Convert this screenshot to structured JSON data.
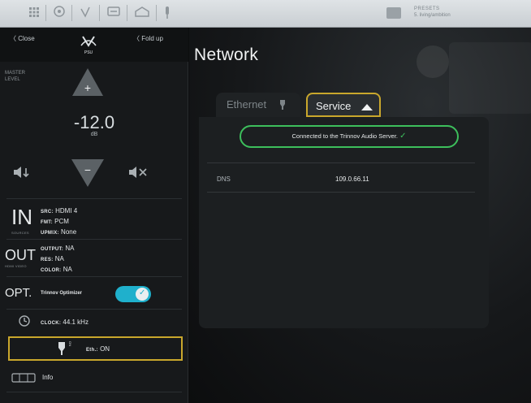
{
  "topbar": {
    "presets_label": "PRESETS",
    "preset_name": "5. living/ambition"
  },
  "sidebar": {
    "close_label": "Close",
    "fold_label": "Fold up",
    "logo_text": "PSU",
    "master_level_label": "MASTER\nLEVEL",
    "volume_value": "-12.0",
    "volume_unit": "dB",
    "input": {
      "big": "IN",
      "caption": "SOURCES",
      "src_key": "SRC:",
      "src_val": "HDMI 4",
      "fmt_key": "FMT:",
      "fmt_val": "PCM",
      "upmix_key": "UPMIX:",
      "upmix_val": "None"
    },
    "output": {
      "big": "OUT",
      "caption": "HDMI VIDEO",
      "output_key": "OUTPUT:",
      "output_val": "NA",
      "res_key": "RES:",
      "res_val": "NA",
      "color_key": "COLOR:",
      "color_val": "NA"
    },
    "optimizer": {
      "big": "OPT.",
      "label": "Trinnov Optimizer",
      "enabled": true
    },
    "clock": {
      "key": "CLOCK:",
      "val": "44.1 kHz"
    },
    "ethernet": {
      "plug_text": "ON",
      "key": "Eth.:",
      "val": "ON"
    },
    "info_label": "Info"
  },
  "main": {
    "title": "Network",
    "tabs": [
      {
        "label": "Ethernet",
        "icon": "plug-icon"
      },
      {
        "label": "Service",
        "icon": "cloud-icon"
      }
    ],
    "active_tab": "Service",
    "status_text": "Connected to the Trinnov Audio Server.",
    "dns_label": "DNS",
    "dns_value": "109.0.66.11",
    "status_color": "#3dbf5c",
    "accent_color": "#1fb0cc",
    "highlight_color": "#c9a72c"
  }
}
